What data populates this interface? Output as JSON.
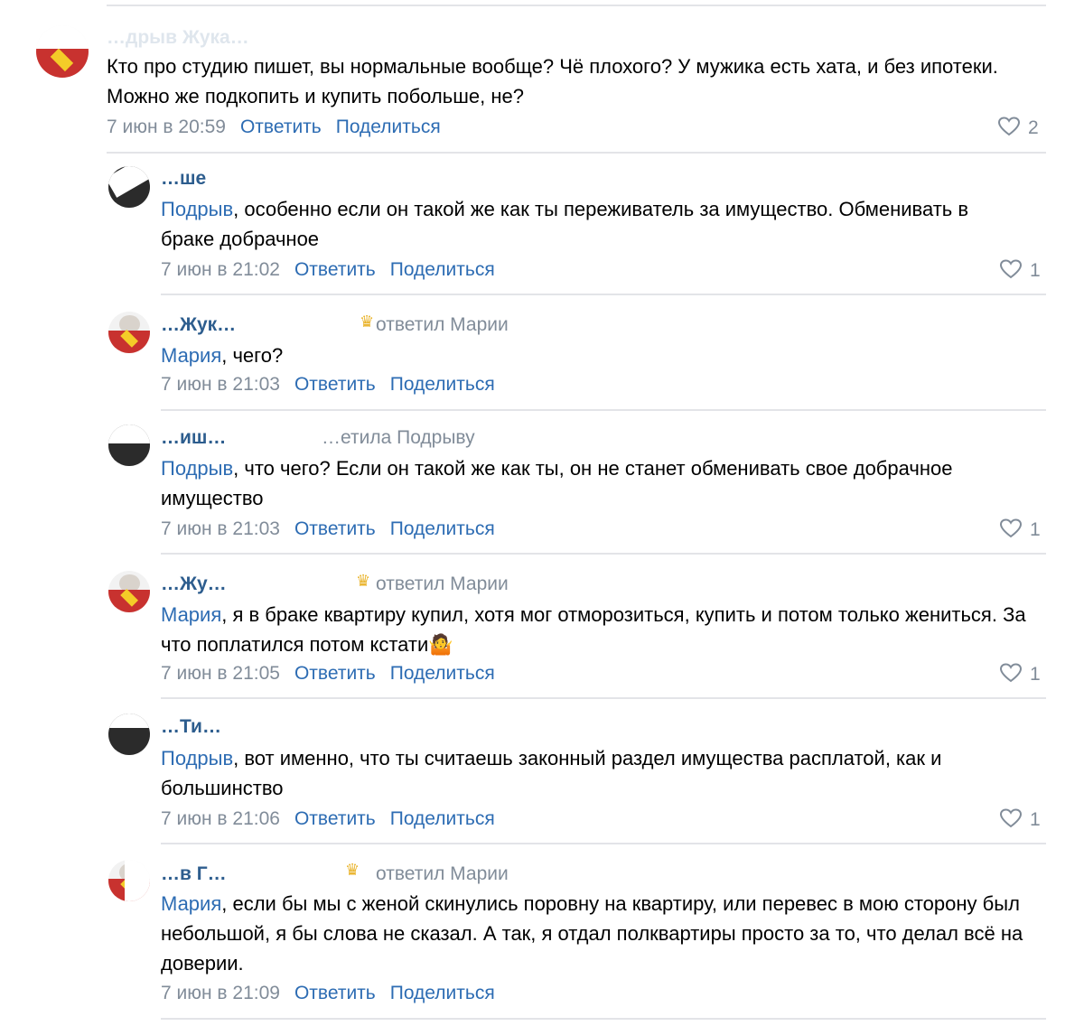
{
  "comments": [
    {
      "author": "…дрыв Жука…",
      "mention": "",
      "body": "Кто про студию пишет, вы нормальные вообще? Чё плохого? У мужика есть хата, и без ипотеки. Можно же подкопить и купить побольше, не?",
      "time": "7 июн в 20:59",
      "reply_label": "Ответить",
      "share_label": "Поделиться",
      "likes": "2"
    },
    {
      "author": "…ше",
      "mention": "Подрыв",
      "body": ", особенно если он такой же как ты переживатель за имущество. Обменивать в браке добрачное",
      "time": "7 июн в 21:02",
      "reply_label": "Ответить",
      "share_label": "Поделиться",
      "likes": "1"
    },
    {
      "author": "…Жук…",
      "replied": "ответил Марии",
      "mention": "Мария",
      "body": ", чего?",
      "time": "7 июн в 21:03",
      "reply_label": "Ответить",
      "share_label": "Поделиться",
      "likes": ""
    },
    {
      "author": "…иш…",
      "replied": "…етила Подрыву",
      "mention": "Подрыв",
      "body": ", что чего? Если он такой же как ты, он не станет обменивать свое добрачное имущество",
      "time": "7 июн в 21:03",
      "reply_label": "Ответить",
      "share_label": "Поделиться",
      "likes": "1"
    },
    {
      "author": "…Жу…",
      "replied": "ответил Марии",
      "mention": "Мария",
      "body": ", я в браке квартиру купил, хотя мог отморозиться, купить и потом только жениться. За что поплатился потом кстати🤷",
      "time": "7 июн в 21:05",
      "reply_label": "Ответить",
      "share_label": "Поделиться",
      "likes": "1"
    },
    {
      "author": "…Ти…",
      "mention": "Подрыв",
      "body": ", вот именно, что ты считаешь законный раздел имущества расплатой, как и большинство",
      "time": "7 июн в 21:06",
      "reply_label": "Ответить",
      "share_label": "Поделиться",
      "likes": "1"
    },
    {
      "author": "…в Г…",
      "replied": "ответил Марии",
      "mention": "Мария",
      "body": ", если бы мы с женой скинулись поровну на квартиру, или перевес в мою сторону был небольшой, я бы слова не сказал. А так, я отдал полквартиры просто за то, что делал всё на доверии.",
      "time": "7 июн в 21:09",
      "reply_label": "Ответить",
      "share_label": "Поделиться",
      "likes": ""
    }
  ]
}
